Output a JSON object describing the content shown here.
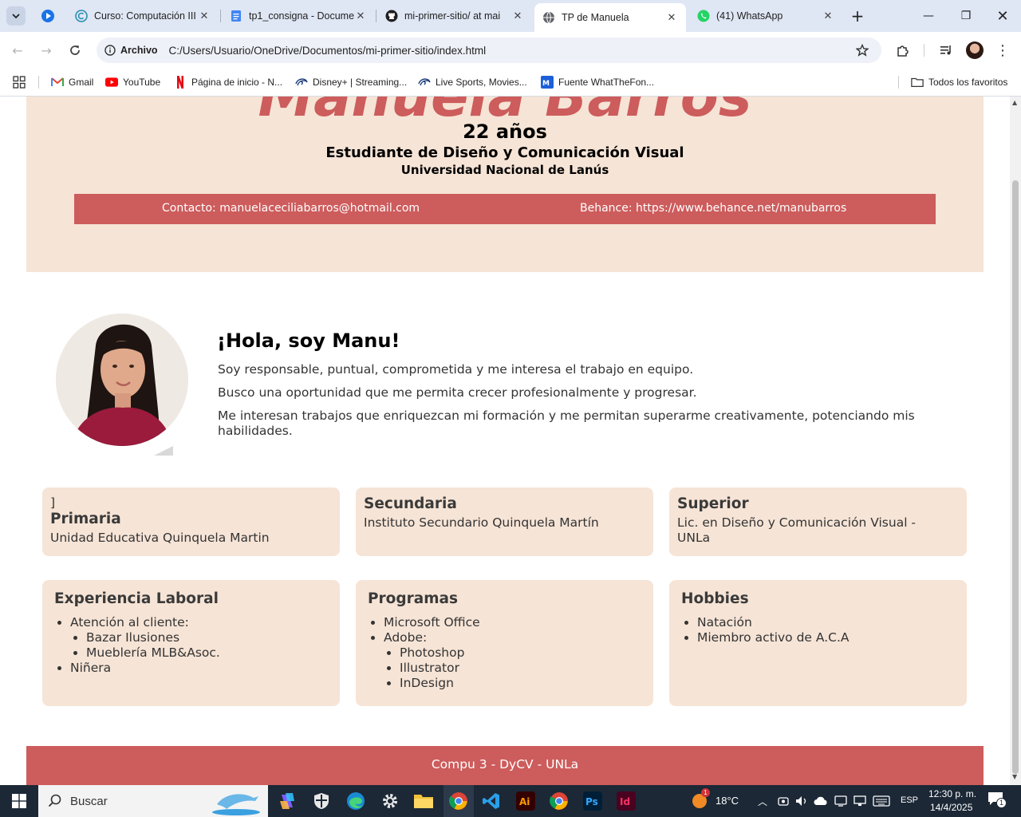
{
  "browser": {
    "tabs": [
      {
        "title": "Curso: Computación III",
        "favicon": "course-icon"
      },
      {
        "title": "tp1_consigna - Docume",
        "favicon": "docs-icon"
      },
      {
        "title": "mi-primer-sitio/ at mai",
        "favicon": "github-icon"
      },
      {
        "title": "TP de Manuela",
        "favicon": "globe-icon",
        "active": true
      },
      {
        "title": "(41) WhatsApp",
        "favicon": "whatsapp-icon"
      }
    ],
    "address": {
      "chip": "Archivo",
      "url": "C:/Users/Usuario/OneDrive/Documentos/mi-primer-sitio/index.html"
    },
    "bookmarks": [
      "Gmail",
      "YouTube",
      "Página de inicio - N...",
      "Disney+ | Streaming...",
      "Live Sports, Movies...",
      "Fuente WhatTheFon..."
    ],
    "all_bookmarks": "Todos los favoritos"
  },
  "page": {
    "header": {
      "name": "Manuela Barros",
      "age": "22 años",
      "career": "Estudiante de Diseño y Comunicación Visual",
      "university": "Universidad Nacional de Lanús",
      "contact": "Contacto: manuelaceciliabarros@hotmail.com",
      "behance": "Behance: https://www.behance.net/manubarros"
    },
    "about": {
      "greeting": "¡Hola, soy Manu!",
      "p1": "Soy responsable, puntual, comprometida y me interesa el trabajo en equipo.",
      "p2": "Busco una oportunidad que me permita crecer profesionalmente y progresar.",
      "p3": "Me interesan trabajos que enriquezcan mi formación y me permitan superarme creativamente, potenciando mis habilidades."
    },
    "education": [
      {
        "stray": "]",
        "title": "Primaria",
        "text": "Unidad Educativa Quinquela Martin"
      },
      {
        "title": "Secundaria",
        "text": "Instituto Secundario Quinquela Martín"
      },
      {
        "title": "Superior",
        "text": "Lic. en Diseño y Comunicación Visual - UNLa"
      }
    ],
    "experience": {
      "title": "Experiencia Laboral",
      "item1": "Atención al cliente:",
      "sub1": "Bazar Ilusiones",
      "sub2": "Mueblería MLB&Asoc.",
      "item2": "Niñera"
    },
    "programs": {
      "title": "Programas",
      "item1": "Microsoft Office",
      "item2": "Adobe:",
      "sub1": "Photoshop",
      "sub2": "Illustrator",
      "sub3": "InDesign"
    },
    "hobbies": {
      "title": "Hobbies",
      "item1": "Natación",
      "item2": "Miembro activo de A.C.A"
    },
    "footer": "Compu 3 - DyCV - UNLa"
  },
  "taskbar": {
    "search": "Buscar",
    "weather": "18°C",
    "weather_badge": "1",
    "lang": "ESP",
    "time": "12:30 p. m.",
    "date": "14/4/2025",
    "notif_badge": "1"
  },
  "colors": {
    "accent": "#cd5c5c",
    "card_bg": "#f6e4d6",
    "tabstrip": "#dfe6f4"
  }
}
